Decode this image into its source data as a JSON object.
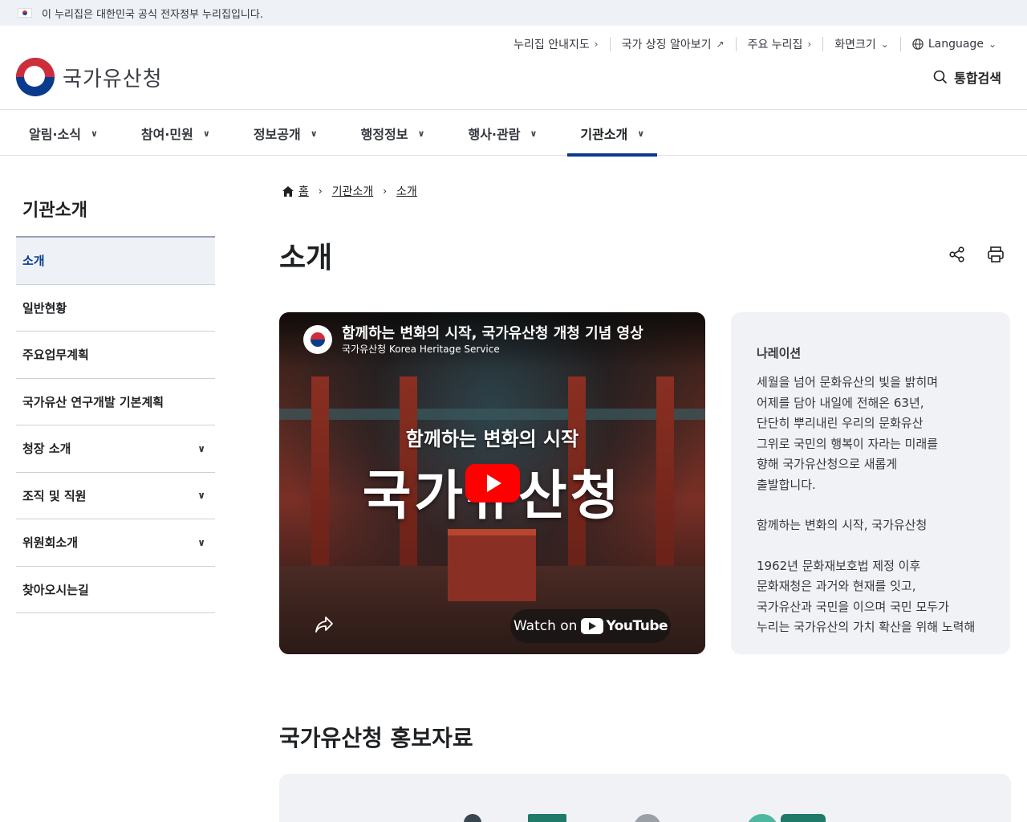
{
  "gov_banner": {
    "text": "이 누리집은 대한민국 공식 전자정부 누리집입니다."
  },
  "header": {
    "logo_text": "국가유산청",
    "util_nav": [
      {
        "label": "누리집 안내지도",
        "icon": "chevron-right-icon",
        "glyph": "›"
      },
      {
        "label": "국가 상징 알아보기",
        "icon": "external-link-icon",
        "glyph": "↗"
      },
      {
        "label": "주요 누리집",
        "icon": "chevron-right-icon",
        "glyph": "›"
      },
      {
        "label": "화면크기",
        "icon": "chevron-down-icon",
        "glyph": "⌄"
      },
      {
        "label": "Language",
        "icon": "chevron-down-icon",
        "glyph": "⌄"
      }
    ],
    "search_label": "통합검색"
  },
  "main_nav": [
    {
      "label": "알림·소식"
    },
    {
      "label": "참여·민원"
    },
    {
      "label": "정보공개"
    },
    {
      "label": "행정정보"
    },
    {
      "label": "행사·관람"
    },
    {
      "label": "기관소개",
      "active": true
    }
  ],
  "sidebar": {
    "title": "기관소개",
    "items": [
      {
        "label": "소개",
        "active": true,
        "expandable": false
      },
      {
        "label": "일반현황",
        "expandable": false
      },
      {
        "label": "주요업무계획",
        "expandable": false
      },
      {
        "label": "국가유산 연구개발 기본계획",
        "expandable": false
      },
      {
        "label": "청장 소개",
        "expandable": true
      },
      {
        "label": "조직 및 직원",
        "expandable": true
      },
      {
        "label": "위원회소개",
        "expandable": true
      },
      {
        "label": "찾아오시는길",
        "expandable": false
      }
    ]
  },
  "breadcrumb": {
    "home": "홈",
    "level1": "기관소개",
    "level2": "소개"
  },
  "page_title": "소개",
  "video": {
    "title": "함께하는 변화의 시작, 국가유산청 개청 기념 영상",
    "channel": "국가유산청 Korea Heritage Service",
    "headline": "함께하는 변화의 시작",
    "big_text": "국가유산청",
    "watch_on": "Watch on",
    "youtube": "YouTube"
  },
  "narration": {
    "title": "나레이션",
    "para1": "세월을 넘어 문화유산의 빛을 밝히며\n어제를 담아 내일에 전해온 63년,\n단단히 뿌리내린 우리의 문화유산\n그위로 국민의 행복이 자라는 미래를\n향해 국가유산청으로 새롭게\n출발합니다.",
    "para2": "함께하는 변화의 시작, 국가유산청",
    "para3": "1962년 문화재보호법 제정 이후\n문화재청은 과거와 현재를 잇고,\n국가유산과 국민을 이으며 국민 모두가\n누리는 국가유산의 가치 확산을 위해 노력해"
  },
  "promo": {
    "title": "국가유산청 홍보자료"
  },
  "colors": {
    "accent": "#083891",
    "banner_bg": "#eef1f6",
    "panel_bg": "#f0f2f5"
  }
}
